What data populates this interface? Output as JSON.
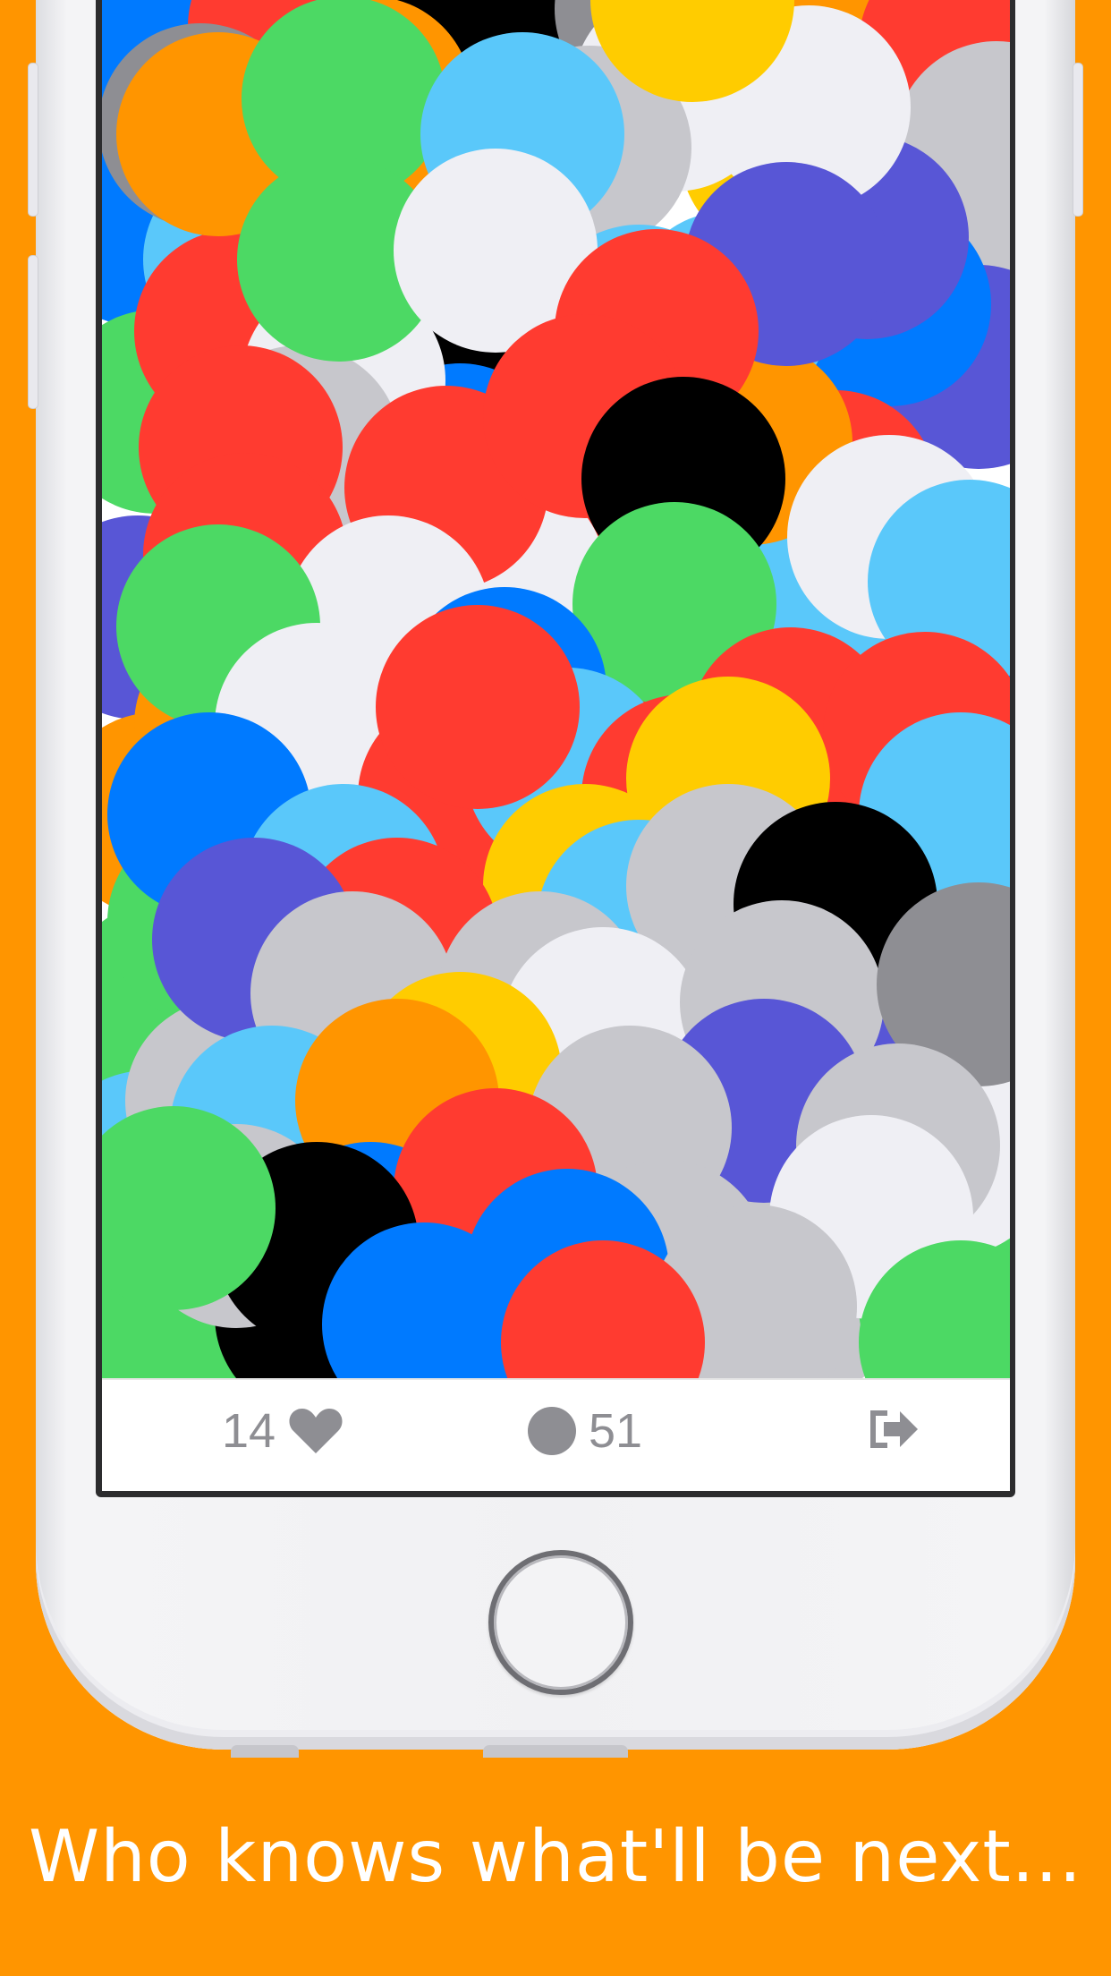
{
  "app": {
    "likes_count": "14",
    "circles_count": "51"
  },
  "icons": {
    "like": "heart-icon",
    "circle": "circle-icon",
    "share": "share-icon"
  },
  "palette": [
    "#FF3B30",
    "#007AFF",
    "#4CD964",
    "#FFCC00",
    "#FF9500",
    "#5AC8FA",
    "#5856D6",
    "#000000",
    "#EFEFF4",
    "#C7C7CC",
    "#8E8E93"
  ],
  "caption": "Who knows what'll be next..."
}
